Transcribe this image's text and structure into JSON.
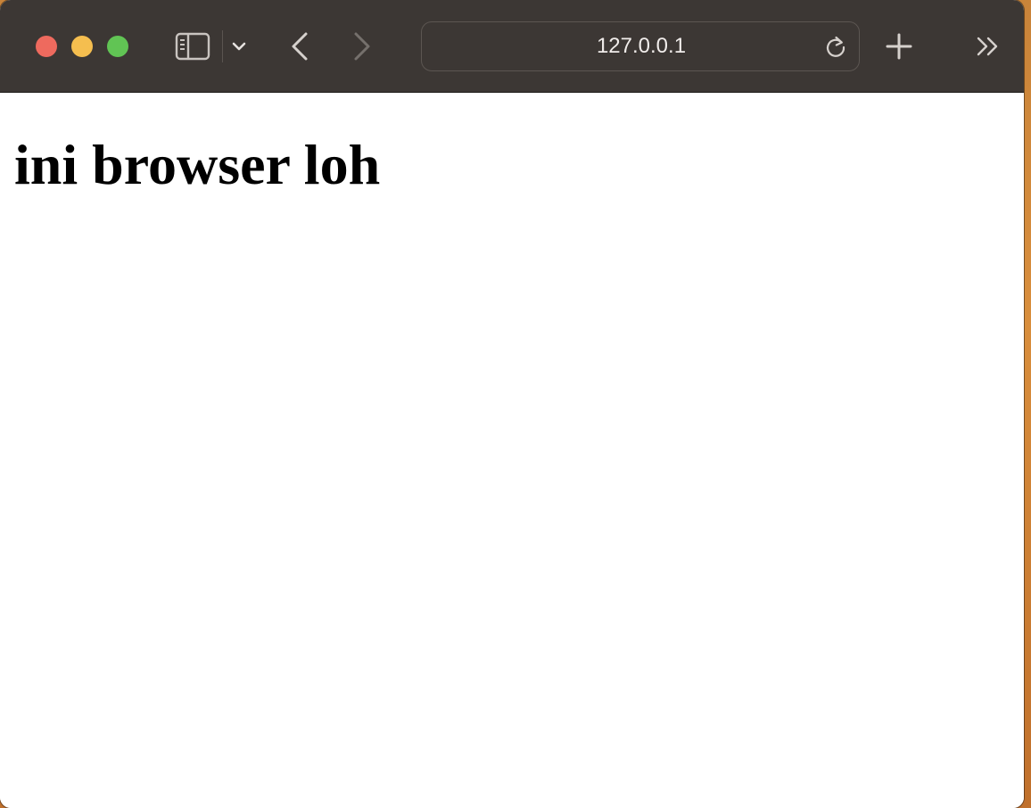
{
  "browser": {
    "toolbar": {
      "traffic_lights": {
        "close_color": "#ee6a5e",
        "minimize_color": "#f5be4f",
        "zoom_color": "#61c454"
      },
      "icons": {
        "sidebar": "sidebar-icon",
        "tab_menu": "chevron-down-icon",
        "back": "chevron-left-icon",
        "forward": "chevron-right-icon",
        "reload": "reload-icon",
        "new_tab": "plus-icon",
        "overflow": "double-chevron-right-icon"
      }
    },
    "address_bar": {
      "url": "127.0.0.1"
    }
  },
  "page": {
    "heading": "ini browser loh"
  },
  "colors": {
    "toolbar_bg": "#3c3734",
    "page_bg": "#ffffff",
    "text": "#000000"
  }
}
